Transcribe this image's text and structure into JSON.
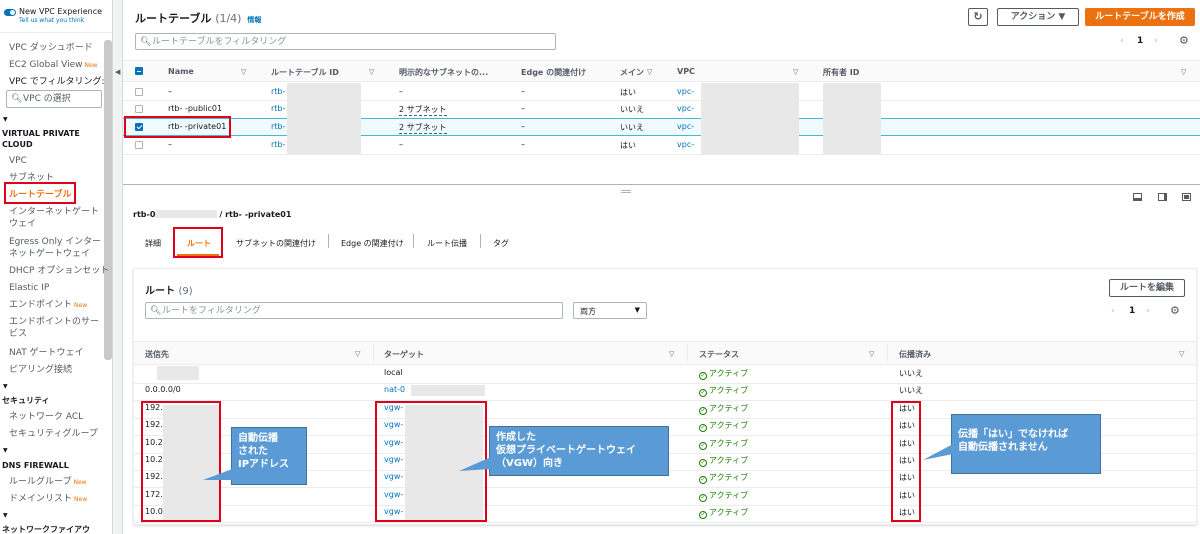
{
  "sidebar": {
    "new_vpc_label": "New VPC Experience",
    "new_vpc_sub": "Tell us what you think",
    "dashboard": "VPC ダッシュボード",
    "ec2_global": "EC2 Global View",
    "filter_label": "VPC でフィルタリング:",
    "vpc_select_placeholder": "VPC の選択",
    "section_vpc": "VIRTUAL PRIVATE CLOUD",
    "vpc": "VPC",
    "subnet": "サブネット",
    "route_table": "ルートテーブル",
    "igw": "インターネットゲートウェイ",
    "egress_igw": "Egress Only インターネットゲートウェイ",
    "dhcp": "DHCP オプションセット",
    "eip": "Elastic IP",
    "endpoint": "エンドポイント",
    "endpoint_service": "エンドポイントのサービス",
    "nat": "NAT ゲートウェイ",
    "peering": "ピアリング接続",
    "section_security": "セキュリティ",
    "nacl": "ネットワーク ACL",
    "sg": "セキュリティグループ",
    "section_dns": "DNS FIREWALL",
    "rule_group": "ルールグループ",
    "domain_list": "ドメインリスト",
    "section_nfw": "ネットワークファイアウ",
    "new_badge": "New"
  },
  "header": {
    "title": "ルートテーブル",
    "count": "(1/4)",
    "info": "情報",
    "refresh_icon": "refresh-icon",
    "actions": "アクション ▼",
    "create": "ルートテーブルを作成",
    "filter_placeholder": "ルートテーブルをフィルタリング",
    "page": "1"
  },
  "table": {
    "columns": [
      "Name",
      "ルートテーブル ID",
      "明示的なサブネットの...",
      "Edge の関連付け",
      "メイン",
      "VPC",
      "所有者 ID"
    ],
    "rows": [
      {
        "name": "–",
        "id": "rtb-",
        "subnet": "–",
        "edge": "–",
        "main": "はい",
        "vpc": "vpc-",
        "selected": false
      },
      {
        "name": "rtb-   -public01",
        "id": "rtb-",
        "subnet": "2 サブネット",
        "edge": "–",
        "main": "いいえ",
        "vpc": "vpc-",
        "selected": false
      },
      {
        "name": "rtb-   -private01",
        "id": "rtb-",
        "subnet": "2 サブネット",
        "edge": "–",
        "main": "いいえ",
        "vpc": "vpc-",
        "selected": true
      },
      {
        "name": "–",
        "id": "rtb-",
        "subnet": "–",
        "edge": "–",
        "main": "はい",
        "vpc": "vpc-",
        "selected": false
      }
    ]
  },
  "detail": {
    "breadcrumb_left": "rtb-0",
    "breadcrumb_right": "/ rtb-   -private01",
    "tabs": [
      "詳細",
      "ルート",
      "サブネットの関連付け",
      "Edge の関連付け",
      "ルート伝播",
      "タグ"
    ],
    "routes_title": "ルート",
    "routes_count": "(9)",
    "edit_routes": "ルートを編集",
    "route_filter_placeholder": "ルートをフィルタリング",
    "direction": "両方",
    "page": "1",
    "columns": [
      "送信先",
      "ターゲット",
      "ステータス",
      "伝播済み"
    ],
    "rows": [
      {
        "dest": "",
        "target": "local",
        "status": "アクティブ",
        "prop": "いいえ"
      },
      {
        "dest": "0.0.0.0/0",
        "target": "nat-0",
        "status": "アクティブ",
        "prop": "いいえ"
      },
      {
        "dest": "192.",
        "target": "vgw-",
        "status": "アクティブ",
        "prop": "はい"
      },
      {
        "dest": "192.",
        "target": "vgw-",
        "status": "アクティブ",
        "prop": "はい"
      },
      {
        "dest": "10.24",
        "target": "vgw-",
        "status": "アクティブ",
        "prop": "はい"
      },
      {
        "dest": "10.24",
        "target": "vgw-",
        "status": "アクティブ",
        "prop": "はい"
      },
      {
        "dest": "192.",
        "target": "vgw-",
        "status": "アクティブ",
        "prop": "はい"
      },
      {
        "dest": "172.",
        "target": "vgw-",
        "status": "アクティブ",
        "prop": "はい"
      },
      {
        "dest": "10.0.",
        "target": "vgw-",
        "status": "アクティブ",
        "prop": "はい"
      }
    ]
  },
  "callouts": {
    "c1_line1": "自動伝播",
    "c1_line2": "された",
    "c1_line3": "IPアドレス",
    "c2_line1": "作成した",
    "c2_line2": "仮想プライベートゲートウェイ",
    "c2_line3": "（VGW）向き",
    "c3_line1": "伝播「はい」でなければ",
    "c3_line2": "自動伝播されません"
  },
  "colors": {
    "accent": "#ec7211",
    "link": "#0073bb",
    "ok": "#1d8102",
    "callout": "#5b9bd5",
    "highlight": "#e0001a"
  }
}
